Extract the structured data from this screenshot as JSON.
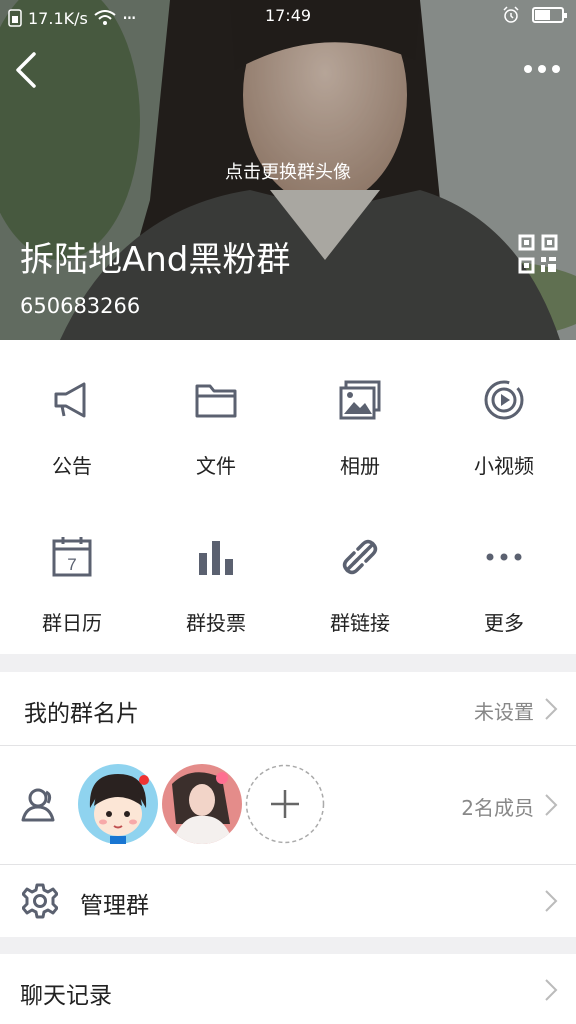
{
  "status": {
    "speed": "17.1K/s",
    "dots": "···",
    "time": "17:49",
    "battery_level": 0.55
  },
  "header": {
    "change_avatar": "点击更换群头像",
    "group_name": "拆陆地And黑粉群",
    "group_id": "650683266"
  },
  "features": [
    {
      "label": "公告",
      "icon": "megaphone-icon"
    },
    {
      "label": "文件",
      "icon": "folder-icon"
    },
    {
      "label": "相册",
      "icon": "album-icon"
    },
    {
      "label": "小视频",
      "icon": "video-icon"
    },
    {
      "label": "群日历",
      "icon": "calendar-icon"
    },
    {
      "label": "群投票",
      "icon": "vote-chart-icon"
    },
    {
      "label": "群链接",
      "icon": "link-icon"
    },
    {
      "label": "更多",
      "icon": "more-dots-icon"
    }
  ],
  "calendar_day": "7",
  "card": {
    "title": "我的群名片",
    "value": "未设置"
  },
  "members": {
    "count_label": "2名成员"
  },
  "manage": {
    "title": "管理群"
  },
  "history": {
    "title": "聊天记录"
  },
  "colors": {
    "icon_gray": "#5b6170",
    "accent": "#000000"
  }
}
